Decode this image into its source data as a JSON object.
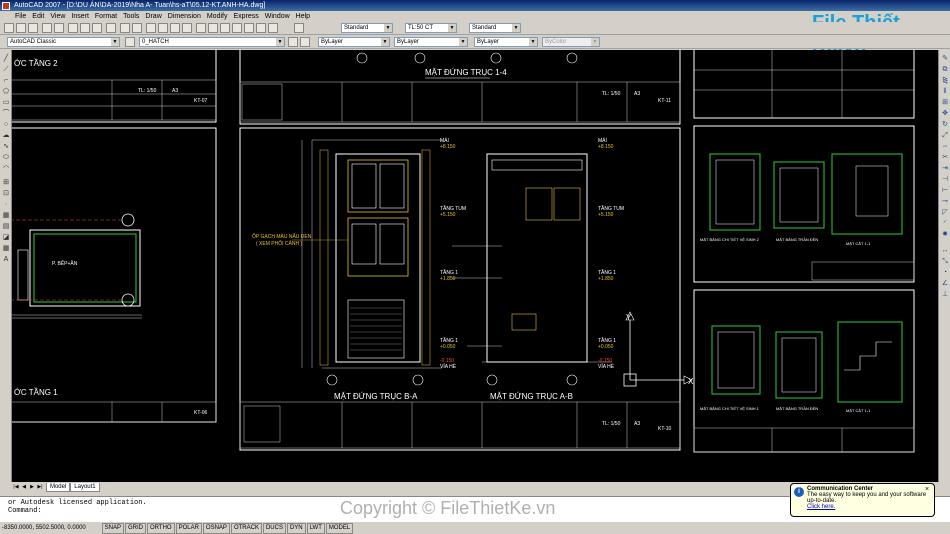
{
  "window": {
    "title": "AutoCAD 2007 - [D:\\DU ÁN\\DA-2019\\Nha A- Tuan\\hs-aT\\05.12-KT.ANH-HA.dwg]"
  },
  "menu": [
    "File",
    "Edit",
    "View",
    "Insert",
    "Format",
    "Tools",
    "Draw",
    "Dimension",
    "Modify",
    "Express",
    "Window",
    "Help"
  ],
  "toolbar": {
    "text_style": "Standard",
    "dim_style": "TL:50 CT",
    "table_style": "Standard",
    "workspace": "AutoCAD Classic",
    "layer": "0_HATCH",
    "color": "ByLayer",
    "linetype": "ByLayer",
    "lineweight": "ByLayer",
    "plotstyle": "ByColor"
  },
  "logo_text": "File Thiết Kế.vn",
  "drawing": {
    "left_top_label": "ỚC TẦNG 2",
    "left_bottom_label": "ỚC TẦNG 1",
    "left_room": "P. BẾP+ĂN",
    "center_title": "MẶT ĐỨNG TRỤC 1-4",
    "elev_left_title": "MẶT ĐỨNG TRỤC B-A",
    "elev_right_title": "MẶT ĐỨNG TRỤC A-B",
    "note": "ỐP GẠCH MÀU NÂU ĐEN",
    "note2": "( XEM PHỐI CẢNH )",
    "level_roof": "MÁI",
    "level_top": "+8.150",
    "level_tum": "TẦNG TUM",
    "level_tum_val": "+5.150",
    "level_1": "TẦNG 1",
    "level_1_val": "+1.850",
    "level_g": "TẦNG 1",
    "level_g_val": "+0.050",
    "level_base": "-0.150",
    "level_base2": "VỈA HÈ",
    "sheet_kt07": "KT-07",
    "sheet_kt06": "KT-06",
    "sheet_kt11": "KT-11",
    "sheet_kt10": "KT-10",
    "scale_a": "TL: 1/50",
    "scale_paper": "A3",
    "right_caption1": "MẶT BẰNG CHI TIẾT VỆ SINH 2",
    "right_caption2": "MẶT BẰNG TRẦN ĐÈN",
    "right_caption3": "MẶT CẮT 1-1",
    "right_caption4": "MẶT BẰNG CHI TIẾT VỆ SINH 1",
    "axis_x": "X",
    "axis_y": "Y"
  },
  "tabs": {
    "model": "Model",
    "layout": "Layout1"
  },
  "command": {
    "line1": "or Autodesk licensed application.",
    "line2": "Command:"
  },
  "watermark": "Copyright © FileThietKe.vn",
  "status": {
    "coords": "-8350.0000, 5502.5000, 0.0000",
    "buttons": [
      "SNAP",
      "GRID",
      "ORTHO",
      "POLAR",
      "OSNAP",
      "OTRACK",
      "DUCS",
      "DYN",
      "LWT",
      "MODEL"
    ]
  },
  "balloon": {
    "title": "Communication Center",
    "body": "The easy way to keep you and your software up-to-date.",
    "link": "Click here."
  }
}
